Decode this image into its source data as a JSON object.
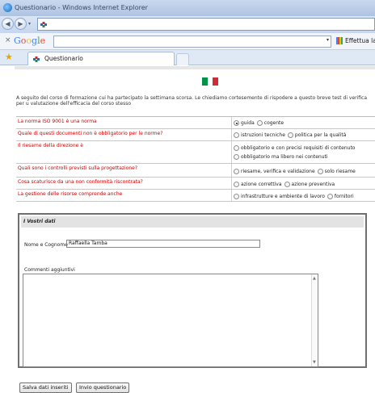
{
  "browser": {
    "window_title": "Questionario - Windows Internet Explorer",
    "search_brand": "Google",
    "translate_label": "Effettua la ri",
    "tab_label": "Questionario"
  },
  "page": {
    "intro": "A seguito del corso di formazione cui ha partecipato la settimana scorsa. Le chiediamo cortesemente di rispodere a questo breve test di verifica per u valutazione dell'efficacia del corso stesso",
    "questions": [
      {
        "text": "La norma ISO 9001 è una norma",
        "options": [
          {
            "label": "guida",
            "selected": true
          },
          {
            "label": "cogente",
            "selected": false
          }
        ]
      },
      {
        "text": "Quale di questi documenti non è obbligatorio per le norme?",
        "options": [
          {
            "label": "istruzioni tecniche",
            "selected": false
          },
          {
            "label": "politica per la qualità",
            "selected": false
          }
        ]
      },
      {
        "text": "Il riesame della direzione è",
        "options": [
          {
            "label": "obbligatorio e con precisi requisiti di contenuto",
            "selected": false
          },
          {
            "label": "obbligatorio ma libero nei contenuti",
            "selected": false
          }
        ]
      },
      {
        "text": "Quali sono i controlli previsti sulla progettazione?",
        "options": [
          {
            "label": "riesame, verifica e validazione",
            "selected": false
          },
          {
            "label": "solo riesame",
            "selected": false
          }
        ]
      },
      {
        "text": "Cosa scaturisce da una non conformità riscontrata?",
        "options": [
          {
            "label": "azione correttiva",
            "selected": false
          },
          {
            "label": "azione preventiva",
            "selected": false
          }
        ]
      },
      {
        "text": "La gestione delle risorse comprende anche",
        "options": [
          {
            "label": "infrastrutture e ambiente di lavoro",
            "selected": false
          },
          {
            "label": "fornitori",
            "selected": false
          }
        ]
      }
    ],
    "panel": {
      "heading": "I Vostri dati",
      "name_label": "Nome e Cognome",
      "name_value": "Raffaella Tamba",
      "comments_label": "Commenti aggiuntivi",
      "comments_value": ""
    },
    "buttons": {
      "save": "Salva dati inseriti",
      "send": "Invio questionario"
    }
  },
  "colors": {
    "question_text": "#cc0000",
    "flag_green": "#009246",
    "flag_white": "#ffffff",
    "flag_red": "#ce2b37"
  }
}
